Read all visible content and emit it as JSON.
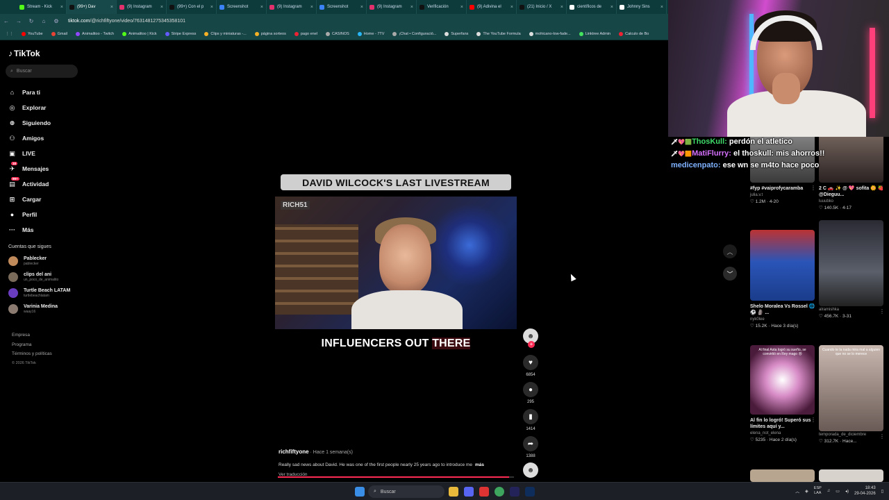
{
  "browser": {
    "tabs": [
      {
        "label": "Stream - Kick",
        "color": "#53fc18",
        "active": false
      },
      {
        "label": "(99+) Dav",
        "color": "#111111",
        "active": true
      },
      {
        "label": "(9) Instagram",
        "color": "#e1306c",
        "active": false
      },
      {
        "label": "(99+) Con el p",
        "color": "#111111",
        "active": false
      },
      {
        "label": "Screenshot",
        "color": "#3b82f6",
        "active": false
      },
      {
        "label": "(9) Instagram",
        "color": "#e1306c",
        "active": false
      },
      {
        "label": "Screenshot",
        "color": "#3b82f6",
        "active": false
      },
      {
        "label": "(9) Instagram",
        "color": "#e1306c",
        "active": false
      },
      {
        "label": "Verificación",
        "color": "#111111",
        "active": false
      },
      {
        "label": "(9) Adivina el",
        "color": "#ff0000",
        "active": false
      },
      {
        "label": "(21) Inicio / X",
        "color": "#111111",
        "active": false
      },
      {
        "label": "científicos de",
        "color": "#ffffff",
        "active": false
      },
      {
        "label": "Johnny Sins",
        "color": "#ffffff",
        "active": false
      }
    ],
    "url_domain": "tiktok.com",
    "url_path": "/@richfiftyone/video/7631481275345358101",
    "bookmarks": [
      {
        "label": "YouTube",
        "color": "#ff0000"
      },
      {
        "label": "Gmail",
        "color": "#ea4335"
      },
      {
        "label": "Animalitoo - Twitch",
        "color": "#9146ff"
      },
      {
        "label": "Animalitoo | Kick",
        "color": "#53fc18"
      },
      {
        "label": "Stripe Express",
        "color": "#635bff"
      },
      {
        "label": "Clips y miniaturas -...",
        "color": "#f6b026"
      },
      {
        "label": "página sorteos",
        "color": "#f6b026"
      },
      {
        "label": "pago enel",
        "color": "#e23"
      },
      {
        "label": "CASINOS",
        "color": "#aaa"
      },
      {
        "label": "Home - 7TV",
        "color": "#29b6f6"
      },
      {
        "label": "¡Chat • Configuració...",
        "color": "#aaa"
      },
      {
        "label": "Superfans",
        "color": "#ddd"
      },
      {
        "label": "The YouTube Formula",
        "color": "#ddd"
      },
      {
        "label": "mohicano-low-fade...",
        "color": "#ddd"
      },
      {
        "label": "Linktree Admin",
        "color": "#43e55e"
      },
      {
        "label": "Calculo de Bo",
        "color": "#e23"
      }
    ]
  },
  "tiktok": {
    "logo": "TikTok",
    "search_placeholder": "Buscar",
    "nav": [
      {
        "label": "Para ti",
        "icon": "home-icon",
        "glyph": "⌂",
        "badge": ""
      },
      {
        "label": "Explorar",
        "icon": "compass-icon",
        "glyph": "◎",
        "badge": ""
      },
      {
        "label": "Siguiendo",
        "icon": "following-icon",
        "glyph": "⊕",
        "badge": ""
      },
      {
        "label": "Amigos",
        "icon": "friends-icon",
        "glyph": "⚇",
        "badge": ""
      },
      {
        "label": "LIVE",
        "icon": "live-icon",
        "glyph": "▣",
        "badge": ""
      },
      {
        "label": "Mensajes",
        "icon": "messages-icon",
        "glyph": "✈",
        "badge": "18"
      },
      {
        "label": "Actividad",
        "icon": "activity-icon",
        "glyph": "▤",
        "badge": "99+"
      },
      {
        "label": "Cargar",
        "icon": "upload-icon",
        "glyph": "⊞",
        "badge": ""
      },
      {
        "label": "Perfil",
        "icon": "profile-icon",
        "glyph": "●",
        "badge": ""
      },
      {
        "label": "Más",
        "icon": "more-icon",
        "glyph": "···",
        "badge": ""
      }
    ],
    "following_header": "Cuentas que sigues",
    "following": [
      {
        "name": "Pablecker",
        "handle": "pablecker",
        "color": "#c08a5a"
      },
      {
        "name": "clips del ani",
        "handle": "un_poco_de_animalito",
        "color": "#7a6a5a"
      },
      {
        "name": "Turtle Beach LATAM",
        "handle": "turtlebeachlatam",
        "color": "#6a3cc0"
      },
      {
        "name": "Varinia Medina",
        "handle": "waay16",
        "color": "#8a7a70"
      }
    ],
    "footer": [
      "Empresa",
      "Programa",
      "Términos y políticas"
    ],
    "copyright": "© 2026 TikTok"
  },
  "video": {
    "title_banner": "DAVID WILCOCK'S LAST LIVESTREAM",
    "watermark": "RICH51",
    "caption_main": "INFLUENCERS OUT ",
    "caption_highlight": "THERE",
    "author": "richfiftyone",
    "time": " · Hace 1 semana(s)",
    "description": "Really sad news about David. He was one of the first people nearly 25 years ago to introduce me",
    "more": "más",
    "translate": "Ver traducción",
    "progress": 0.98,
    "likes": "6854",
    "comments": "295",
    "saves": "1414",
    "shares": "1388"
  },
  "chat": [
    {
      "badges": "🗡💖🟩",
      "user": "ThosKull",
      "color": "#3fdc6a",
      "msg": "perdón el atletico"
    },
    {
      "badges": "🗡💖🟧",
      "user": "MatiFlurry",
      "color": "#d670ff",
      "msg": "el thoskull: mis ahorros!!"
    },
    {
      "badges": "",
      "user": "medicenpato",
      "color": "#7fb2ff",
      "msg": "ese wn se m4to hace poco"
    }
  ],
  "feed": [
    {
      "title": "#fyp #vaiprofycaramba",
      "user": "julia.v.t",
      "stats": "♡ 1.2M · 4-20",
      "overlay": ""
    },
    {
      "title": "2 C 🚗 ✨ @ 💖 sofita 🌼 🍓 @Dieguu...",
      "user": "luuubko",
      "stats": "♡ 140.5K · 4-17",
      "overlay": ""
    },
    {
      "title": "Shelo Moralea Vs Rossel 🌐 ⚽ 🗿 ...",
      "user": "nyk0lee",
      "stats": "♡ 15.2K · Hace 3 día(s)",
      "overlay": ""
    },
    {
      "title": "",
      "user": "alramishka",
      "stats": "♡ 456.7K · 3-31",
      "overlay": ""
    },
    {
      "title": "Al fin lo logró! Superó sus límites aquí y...",
      "user": "elena_not_elena",
      "stats": "♡ 5235 · Hace 2 día(s)",
      "overlay": "Al final Asta logró su sueño, se convirtió en Rey mago 😢"
    },
    {
      "title": "",
      "user": "temporada_de_diciembre",
      "stats": "♡ 312.7K · Hace...",
      "overlay": "Cuando te la nada mira mal a alguien que no se lo merece"
    }
  ],
  "taskbar": {
    "search": "Buscar",
    "lang_top": "ESP",
    "lang_bottom": "LAA",
    "time": "18:43",
    "date": "29-04-2026"
  }
}
